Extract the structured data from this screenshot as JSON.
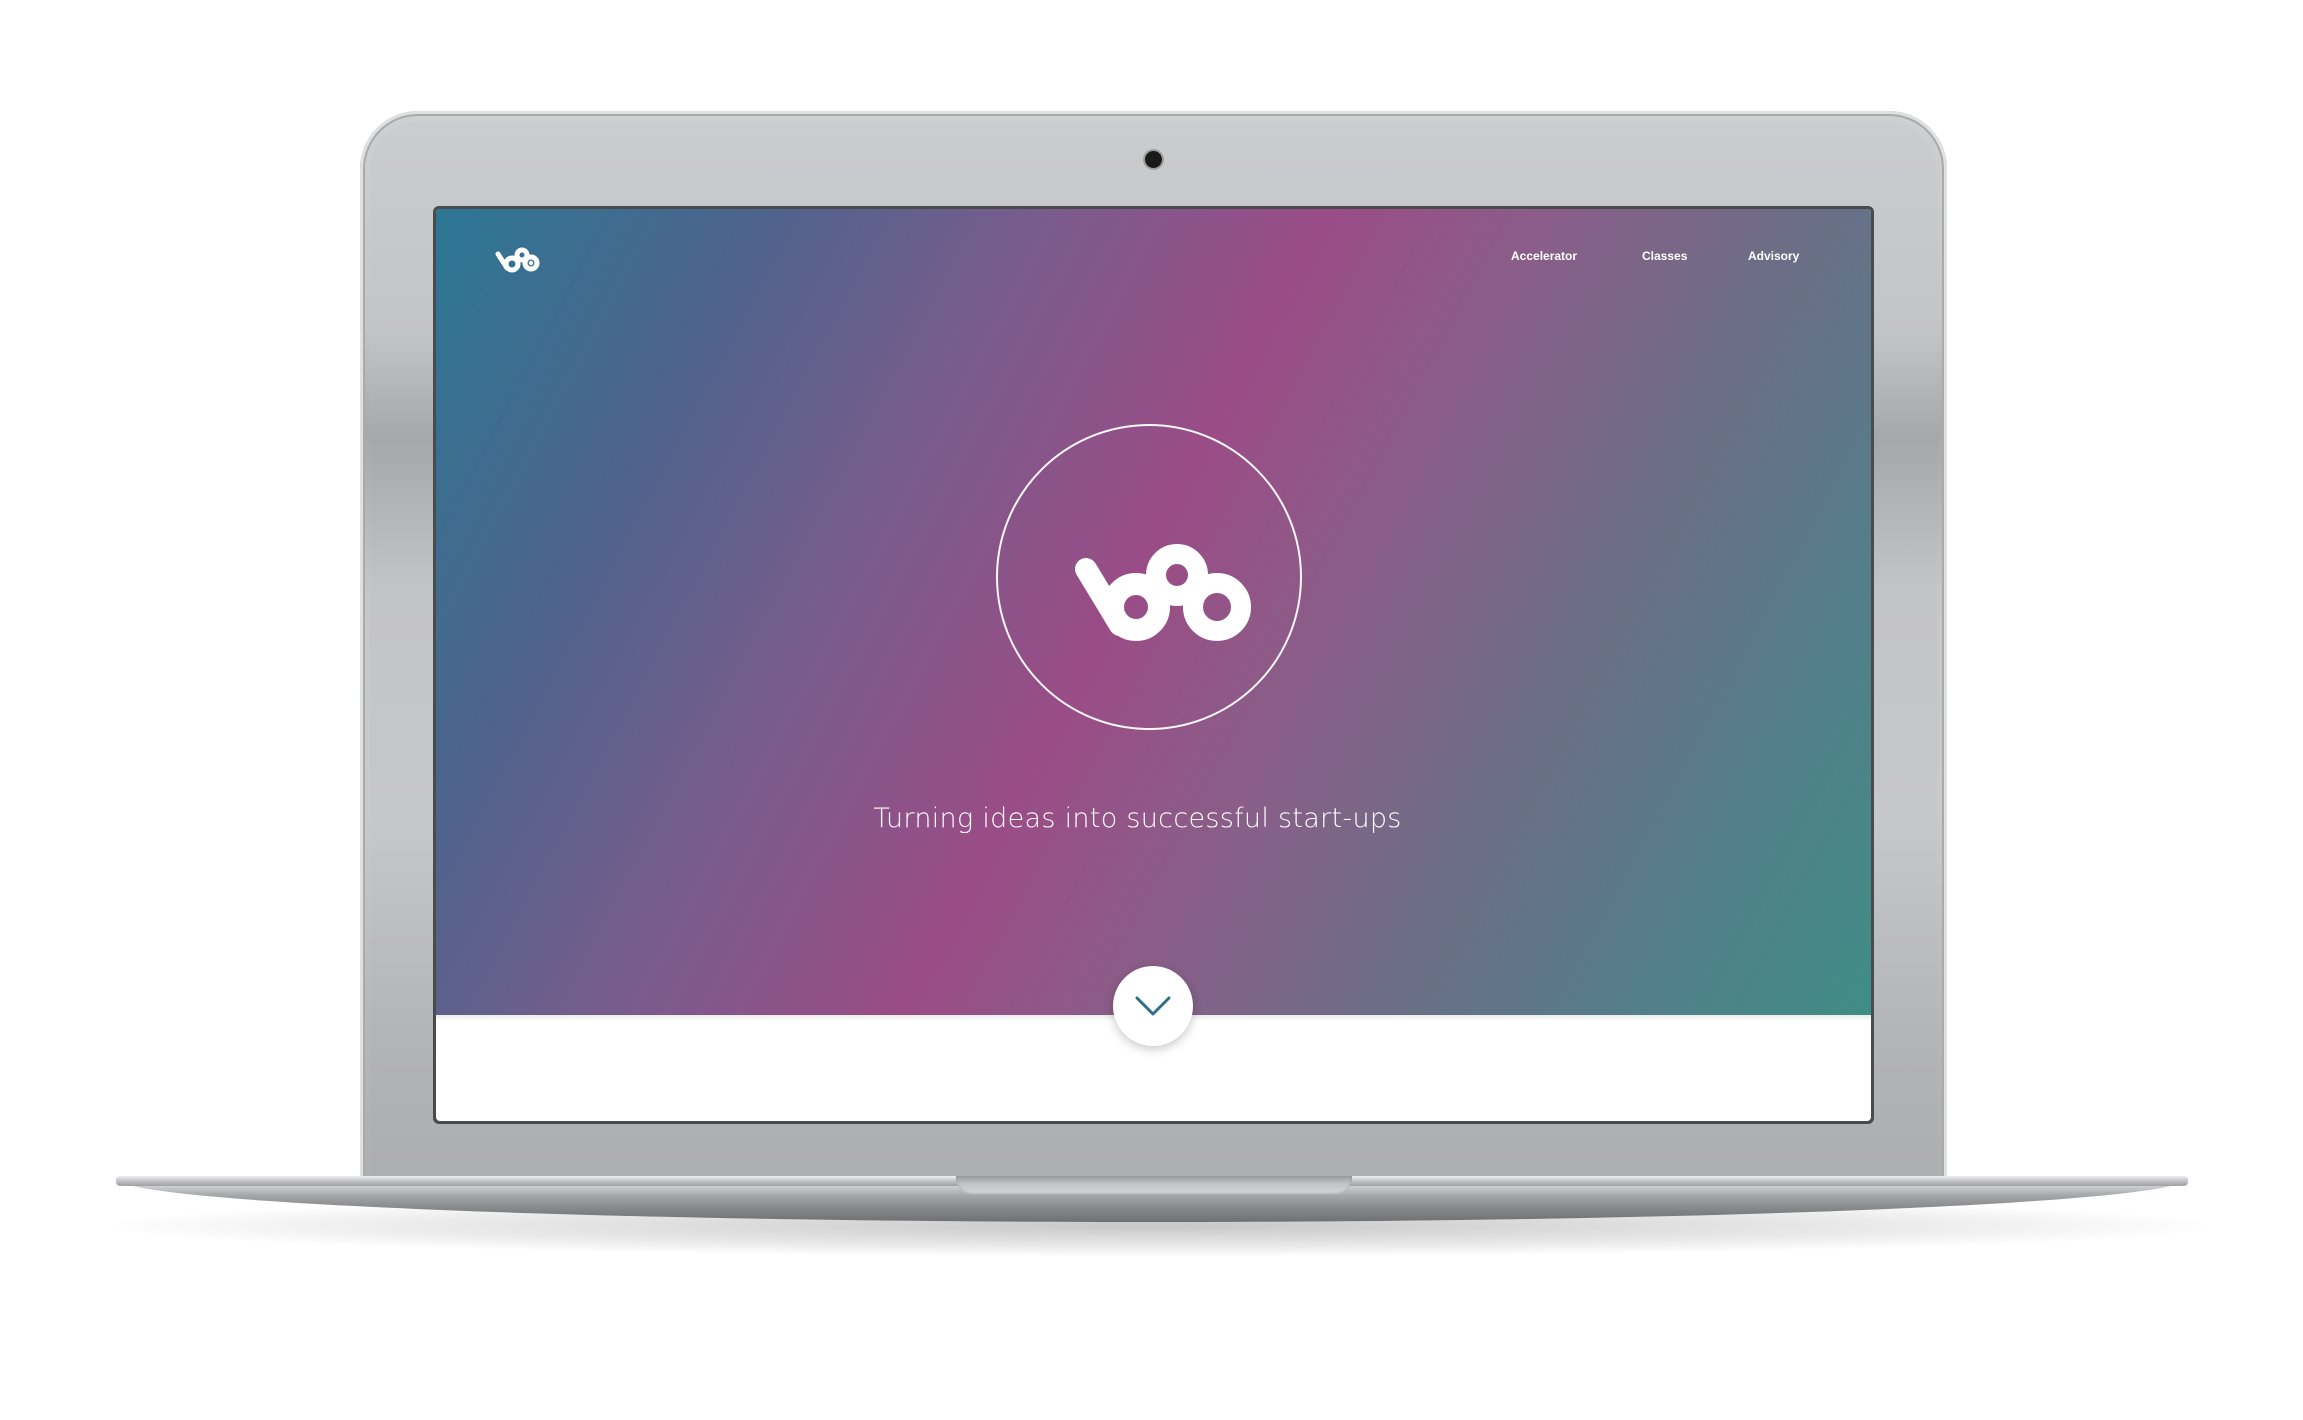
{
  "nav": {
    "items": [
      {
        "label": "Accelerator"
      },
      {
        "label": "Classes"
      },
      {
        "label": "Advisory"
      }
    ]
  },
  "hero": {
    "tagline": "Turning ideas into successful start-ups",
    "gradient_colors": [
      "#2c7794",
      "#9a4c86",
      "#3f8d86"
    ]
  },
  "icons": {
    "logo": "brand-logo-icon",
    "emblem": "brand-emblem-icon",
    "scroll": "chevron-down-icon"
  },
  "colors": {
    "scroll_chevron": "#2f6f8a"
  }
}
